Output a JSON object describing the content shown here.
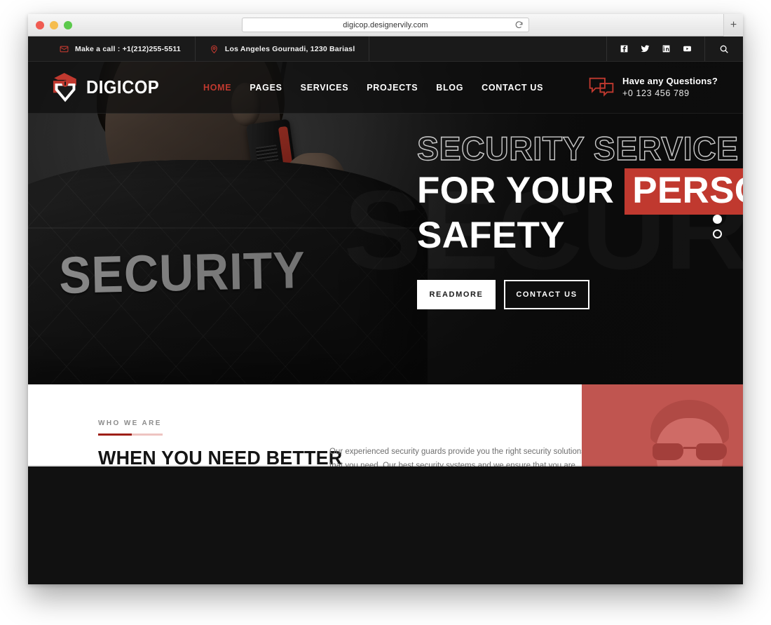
{
  "browser": {
    "url": "digicop.designervily.com",
    "reload_icon": "reload-icon",
    "new_tab_label": "+",
    "traffic_lights": [
      "close",
      "minimize",
      "maximize"
    ]
  },
  "topbar": {
    "phone": "Make a call : +1(212)255-5511",
    "address": "Los Angeles Gournadi, 1230 Bariasl",
    "phone_icon": "envelope-icon",
    "address_icon": "map-pin-icon",
    "socials": [
      {
        "name": "facebook-icon",
        "label": "Facebook"
      },
      {
        "name": "twitter-icon",
        "label": "Twitter"
      },
      {
        "name": "linkedin-icon",
        "label": "LinkedIn"
      },
      {
        "name": "youtube-icon",
        "label": "YouTube"
      }
    ],
    "search_icon": "search-icon"
  },
  "header": {
    "logo_text": "DIGICOP",
    "logo_icon": "shield-badge-icon",
    "nav": [
      {
        "label": "HOME",
        "active": true
      },
      {
        "label": "PAGES",
        "active": false
      },
      {
        "label": "SERVICES",
        "active": false
      },
      {
        "label": "PROJECTS",
        "active": false
      },
      {
        "label": "BLOG",
        "active": false
      },
      {
        "label": "CONTACT US",
        "active": false
      }
    ],
    "questions_title": "Have any Questions?",
    "questions_phone": "+0 123 456 789",
    "questions_icon": "chat-bubbles-icon"
  },
  "hero": {
    "watermark": "SECURITY",
    "jacket_text": "SECURITY",
    "line1": "SECURITY SERVICE",
    "line2_plain": "FOR YOUR ",
    "line2_highlight": "PERSONAL",
    "line3": "SAFETY",
    "btn_primary": "READMORE",
    "btn_secondary": "CONTACT US",
    "highlight_color": "#c0392f",
    "slides": [
      {
        "index": 1,
        "active": true
      },
      {
        "index": 2,
        "active": false
      }
    ]
  },
  "about": {
    "eyebrow": "WHO WE ARE",
    "title": "WHEN YOU NEED BETTER",
    "paragraph": "Our experienced security guards provide you the right security solutions that you need. Our best security systems and we ensure that you are",
    "panel_color": "#c05550"
  }
}
